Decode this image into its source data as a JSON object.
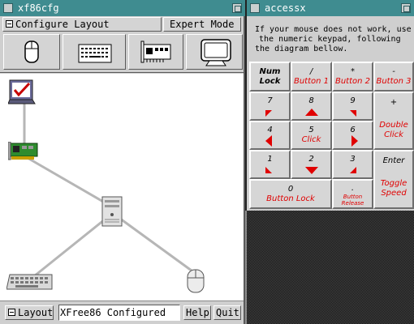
{
  "xf86cfg": {
    "title": "xf86cfg",
    "menu_configure": "Configure Layout",
    "menu_expert": "Expert Mode",
    "toolbar_items": [
      {
        "icon": "mouse-icon"
      },
      {
        "icon": "keyboard-icon"
      },
      {
        "icon": "card-icon"
      },
      {
        "icon": "monitor-icon"
      }
    ],
    "layout_button": "Layout",
    "status": "XFree86 Configured",
    "help_button": "Help",
    "quit_button": "Quit"
  },
  "accessx": {
    "title": "accessx",
    "instructions_lines": [
      "If your mouse does not work, use",
      "the numeric keypad, following",
      "the diagram bellow."
    ],
    "keys": {
      "numlock": {
        "key_line1": "Num",
        "key_line2": "Lock"
      },
      "slash": {
        "key": "/",
        "func": "Button 1"
      },
      "star": {
        "key": "*",
        "func": "Button 2"
      },
      "minus": {
        "key": "-",
        "func": "Button 3"
      },
      "k7": {
        "key": "7"
      },
      "k8": {
        "key": "8"
      },
      "k9": {
        "key": "9"
      },
      "plus": {
        "key": "+",
        "func_line1": "Double",
        "func_line2": "Click"
      },
      "k4": {
        "key": "4"
      },
      "k5": {
        "key": "5",
        "func": "Click"
      },
      "k6": {
        "key": "6"
      },
      "k1": {
        "key": "1"
      },
      "k2": {
        "key": "2"
      },
      "k3": {
        "key": "3"
      },
      "enter": {
        "key": "Enter",
        "func_line1": "Toggle",
        "func_line2": "Speed"
      },
      "k0": {
        "key": "0",
        "func": "Button Lock"
      },
      "dot": {
        "key": ".",
        "func_line1": "Button",
        "func_line2": "Release"
      }
    }
  }
}
